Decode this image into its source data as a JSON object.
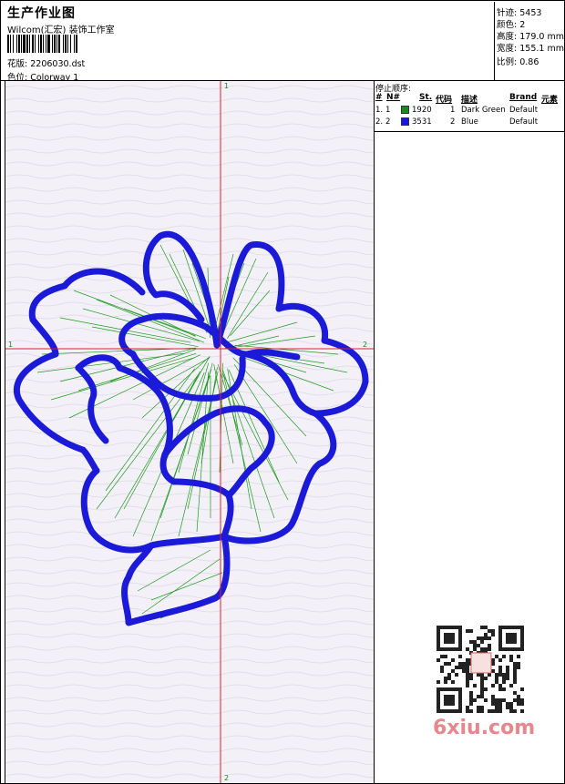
{
  "header": {
    "title": "生产作业图",
    "company": "Wilcom(汇宏) 装饰工作室",
    "design_label": "花版:",
    "design_value": "2206030.dst",
    "colorway_label": "色位:",
    "colorway_value": "Colorway 1"
  },
  "stats": [
    {
      "label": "针迹:",
      "value": "5453"
    },
    {
      "label": "颜色:",
      "value": "2"
    },
    {
      "label": "高度:",
      "value": "179.0 mm"
    },
    {
      "label": "宽度:",
      "value": "155.1 mm"
    },
    {
      "label": "比例:",
      "value": "0.86"
    }
  ],
  "stop_sequence": {
    "title": "停止顺序:",
    "columns": [
      "#",
      "N#",
      "St.",
      "代码",
      "描述",
      "Brand",
      "元素"
    ],
    "rows": [
      {
        "num": "1.",
        "n": "1",
        "stitches": "1920",
        "code": "1",
        "desc": "Dark Green",
        "brand": "Default",
        "color": "#1a8a1a"
      },
      {
        "num": "2.",
        "n": "2",
        "stitches": "3531",
        "code": "2",
        "desc": "Blue",
        "brand": "Default",
        "color": "#1717d8"
      }
    ]
  },
  "crosshair": {
    "top": "1",
    "bottom": "2",
    "left": "1",
    "right": "2"
  },
  "colors": {
    "outline": "#1a1ad8",
    "fill_stitch": "#1f9a1f",
    "guide": "#e0202a",
    "bg": "#f3f1f7"
  },
  "watermark": {
    "text": "6xiu.com",
    "seal": "以秀网"
  }
}
